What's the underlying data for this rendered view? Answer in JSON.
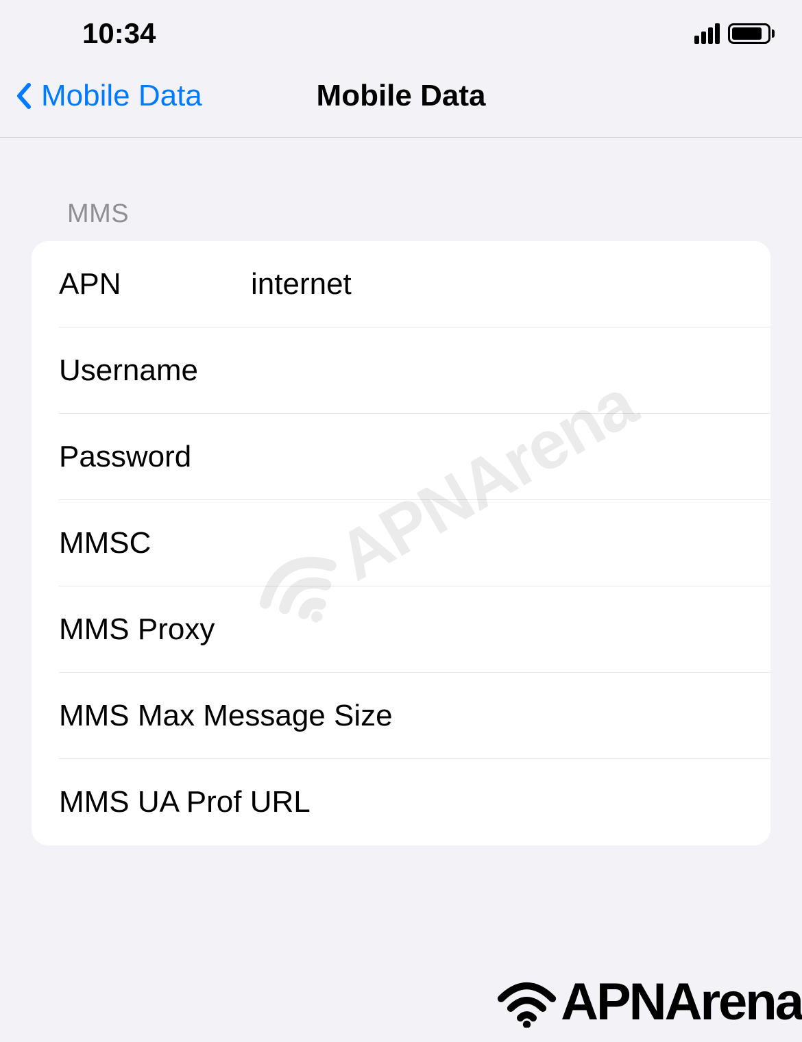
{
  "status_bar": {
    "time": "10:34"
  },
  "nav": {
    "back_label": "Mobile Data",
    "title": "Mobile Data"
  },
  "section": {
    "header": "MMS"
  },
  "rows": {
    "apn": {
      "label": "APN",
      "value": "internet"
    },
    "username": {
      "label": "Username",
      "value": ""
    },
    "password": {
      "label": "Password",
      "value": ""
    },
    "mmsc": {
      "label": "MMSC",
      "value": ""
    },
    "mms_proxy": {
      "label": "MMS Proxy",
      "value": ""
    },
    "mms_max_size": {
      "label": "MMS Max Message Size",
      "value": ""
    },
    "mms_ua_prof": {
      "label": "MMS UA Prof URL",
      "value": ""
    }
  },
  "watermark": {
    "text": "APNArena"
  },
  "footer": {
    "text": "APNArena"
  }
}
